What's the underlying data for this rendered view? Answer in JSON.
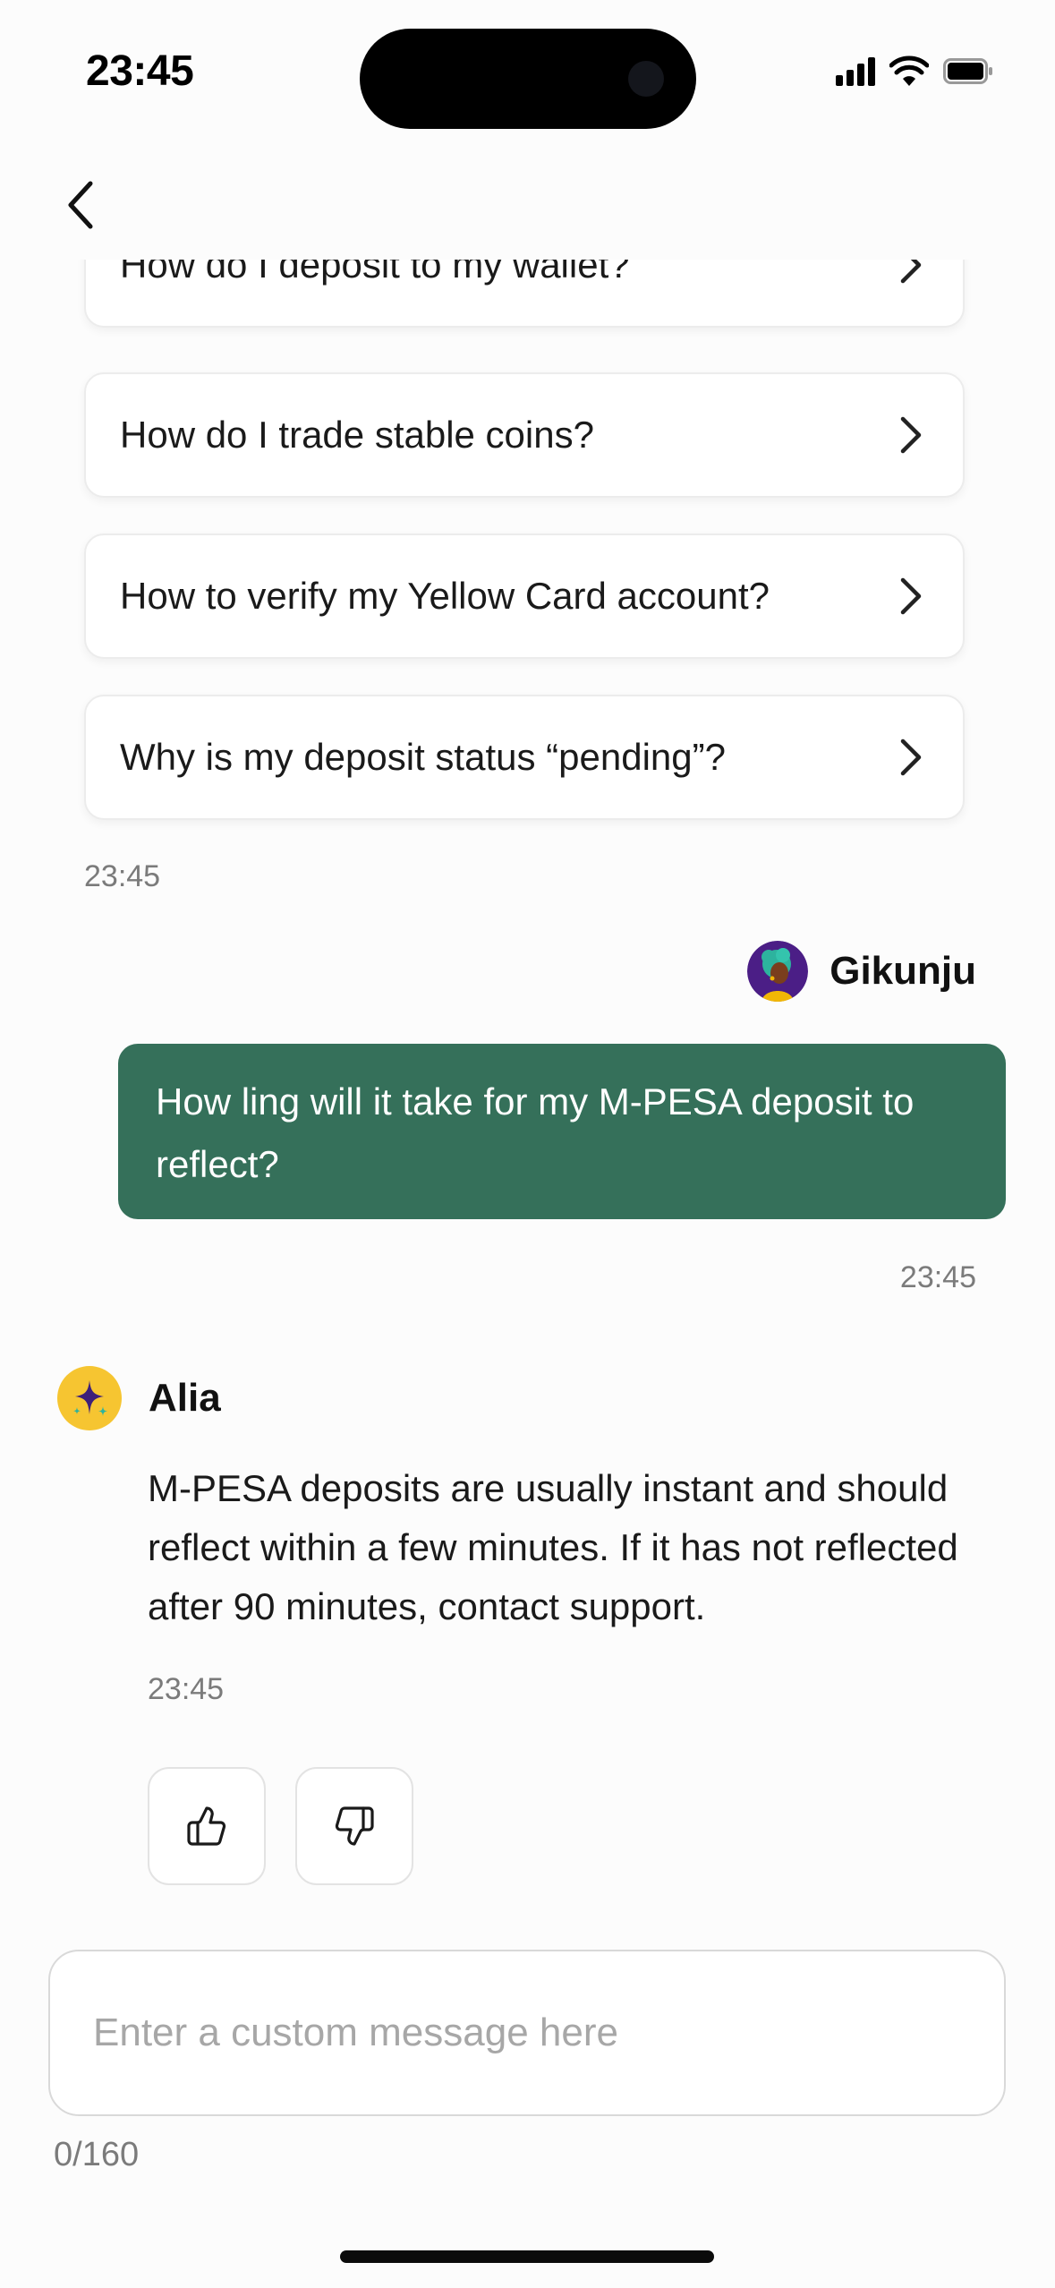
{
  "status_bar": {
    "time": "23:45",
    "icons": [
      "cellular-signal-icon",
      "wifi-icon",
      "battery-icon"
    ]
  },
  "header": {
    "back_icon": "chevron-left-icon"
  },
  "faq": {
    "items": [
      {
        "label": "How do I deposit to my wallet?"
      },
      {
        "label": "How do I trade stable coins?"
      },
      {
        "label": "How to verify my Yellow Card account?"
      },
      {
        "label": "Why is my deposit status “pending”?"
      }
    ],
    "timestamp": "23:45"
  },
  "user_message": {
    "sender": "Gikunju",
    "text": "How ling will it take for my M-PESA deposit to reflect?",
    "timestamp": "23:45"
  },
  "bot_message": {
    "sender": "Alia",
    "text": "M-PESA deposits are usually instant and should reflect within a few minutes. If it has not reflected after 90 minutes, contact support.",
    "timestamp": "23:45",
    "avatar_icon": "sparkle-icon"
  },
  "feedback": {
    "like_icon": "thumbs-up-icon",
    "dislike_icon": "thumbs-down-icon"
  },
  "composer": {
    "placeholder": "Enter a custom message here",
    "value": "",
    "counter": "0/160"
  },
  "colors": {
    "user_bubble": "#35705A",
    "bot_avatar": "#F6C531",
    "background": "#FCFCFC",
    "muted_text": "#7B7B7B"
  }
}
